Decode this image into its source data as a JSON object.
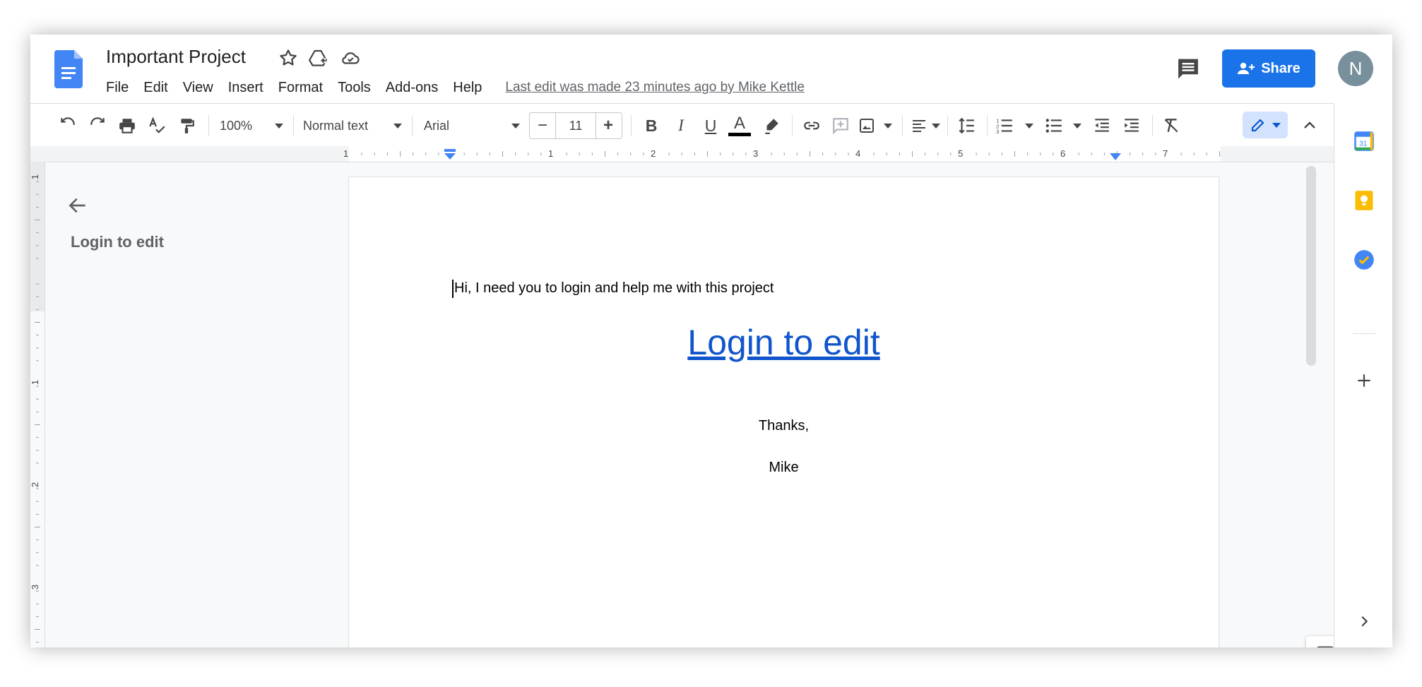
{
  "header": {
    "title": "Important Project",
    "menu": [
      "File",
      "Edit",
      "View",
      "Insert",
      "Format",
      "Tools",
      "Add-ons",
      "Help"
    ],
    "last_edit": "Last edit was made 23 minutes ago by Mike Kettle",
    "share_label": "Share",
    "avatar_initial": "N",
    "icons": [
      "docs-logo-icon",
      "star-icon",
      "move-to-drive-icon",
      "cloud-status-icon",
      "comments-icon",
      "person-add-icon"
    ]
  },
  "toolbar": {
    "zoom": "100%",
    "style": "Normal text",
    "font": "Arial",
    "font_size": "11",
    "minus": "−",
    "plus": "+",
    "bold": "B",
    "italic": "I",
    "underline": "U",
    "text_color_glyph": "A"
  },
  "ruler": {
    "h_numbers": [
      "1",
      "1",
      "2",
      "3",
      "4",
      "5",
      "6",
      "7"
    ],
    "v_numbers": [
      "1",
      "1",
      "2",
      "3"
    ]
  },
  "outline": {
    "title": "Login to edit"
  },
  "document": {
    "line1": "Hi, I need you to login and help me with this project",
    "link": "Login to edit",
    "thanks": "Thanks,",
    "signature": "Mike"
  },
  "colors": {
    "accent": "#1a73e8",
    "link": "#1155cc",
    "avatar": "#78909c",
    "keep": "#fbbc04"
  },
  "side_panel": {
    "calendar_day": "31"
  }
}
